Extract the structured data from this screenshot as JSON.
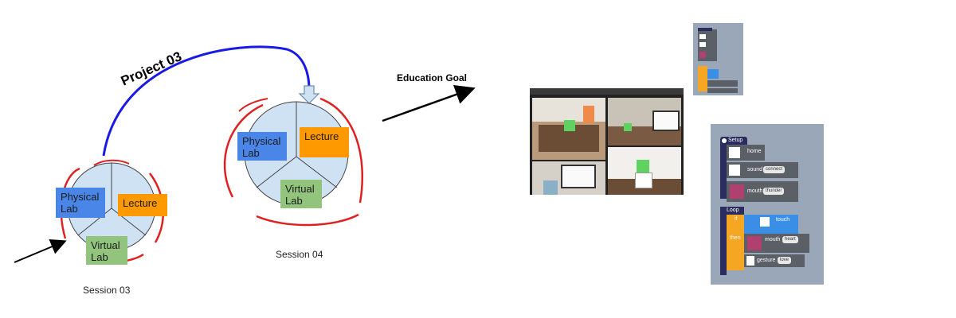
{
  "project_label": "Project 03",
  "education_goal": "Education Goal",
  "session_03": {
    "caption": "Session 03",
    "physical_lab": "Physical\nLab",
    "lecture": "Lecture",
    "virtual_lab": "Virtual\nLab"
  },
  "session_04": {
    "caption": "Session 04",
    "physical_lab": "Physical\nLab",
    "lecture": "Lecture",
    "virtual_lab": "Virtual\nLab"
  },
  "code_blocks": {
    "setup": "Setup",
    "home": "home",
    "sound": "sound",
    "sound_value": "connect",
    "mouth": "mouth",
    "mouth_value": "thunder",
    "loop": "Loop",
    "if": "if",
    "touch": "touch",
    "then": "then",
    "mouth2": "mouth",
    "mouth2_value": "heart",
    "gesture": "gesture",
    "gesture_value": "love"
  },
  "colors": {
    "physical_lab": "#4a86e8",
    "lecture": "#ff9900",
    "virtual_lab": "#93c47d",
    "project_arc": "#1a1ae6",
    "annotation_red": "#e02020",
    "block_setup": "#2b2d5e",
    "block_action": "#5b5f66",
    "block_if": "#f5a623",
    "block_sensor": "#3a8ee6"
  },
  "icons": [
    "down-arrow-icon",
    "robot-icon",
    "speaker-icon",
    "led-matrix-icon",
    "hand-icon",
    "heart-icon"
  ]
}
